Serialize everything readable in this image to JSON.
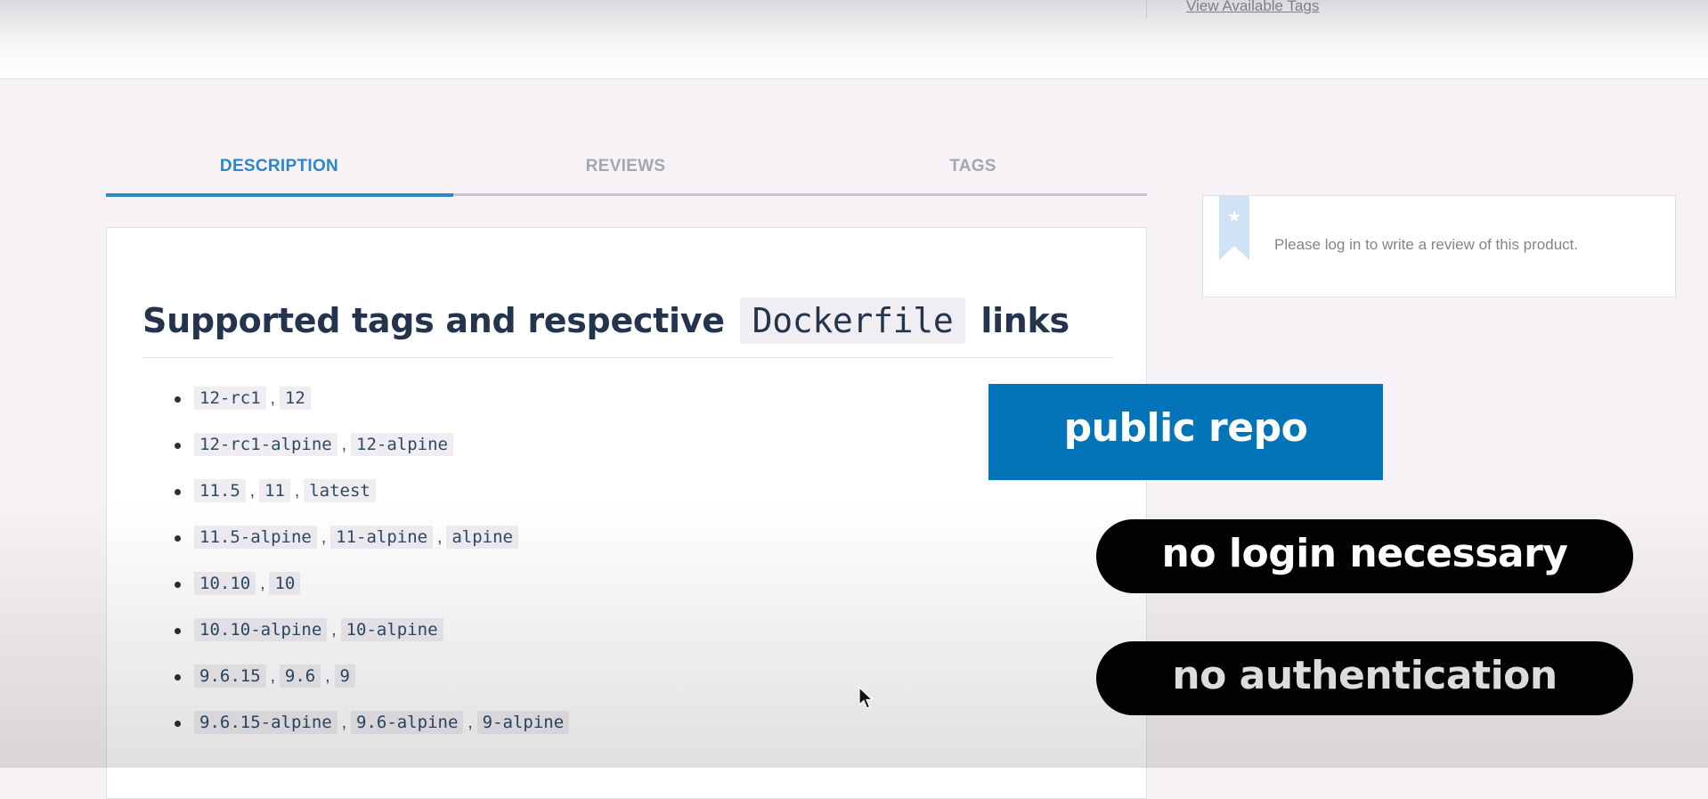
{
  "header": {
    "view_tags_link": "View Available Tags"
  },
  "tabs": [
    {
      "label": "DESCRIPTION",
      "active": true
    },
    {
      "label": "REVIEWS",
      "active": false
    },
    {
      "label": "TAGS",
      "active": false
    }
  ],
  "description": {
    "heading_pre": "Supported tags and respective",
    "heading_code": "Dockerfile",
    "heading_post": "links",
    "tag_rows": [
      [
        "12-rc1",
        "12"
      ],
      [
        "12-rc1-alpine",
        "12-alpine"
      ],
      [
        "11.5",
        "11",
        "latest"
      ],
      [
        "11.5-alpine",
        "11-alpine",
        "alpine"
      ],
      [
        "10.10",
        "10"
      ],
      [
        "10.10-alpine",
        "10-alpine"
      ],
      [
        "9.6.15",
        "9.6",
        "9"
      ],
      [
        "9.6.15-alpine",
        "9.6-alpine",
        "9-alpine"
      ]
    ],
    "separator": ","
  },
  "review_panel": {
    "message": "Please log in to write a review of this product.",
    "icon": "bookmark-star-icon"
  },
  "overlays": {
    "public_repo": "public repo",
    "no_login": "no login necessary",
    "no_auth": "no authentication"
  },
  "colors": {
    "accent": "#2b87c9",
    "badge_blue": "#0474b8",
    "pill_black": "#020202"
  }
}
